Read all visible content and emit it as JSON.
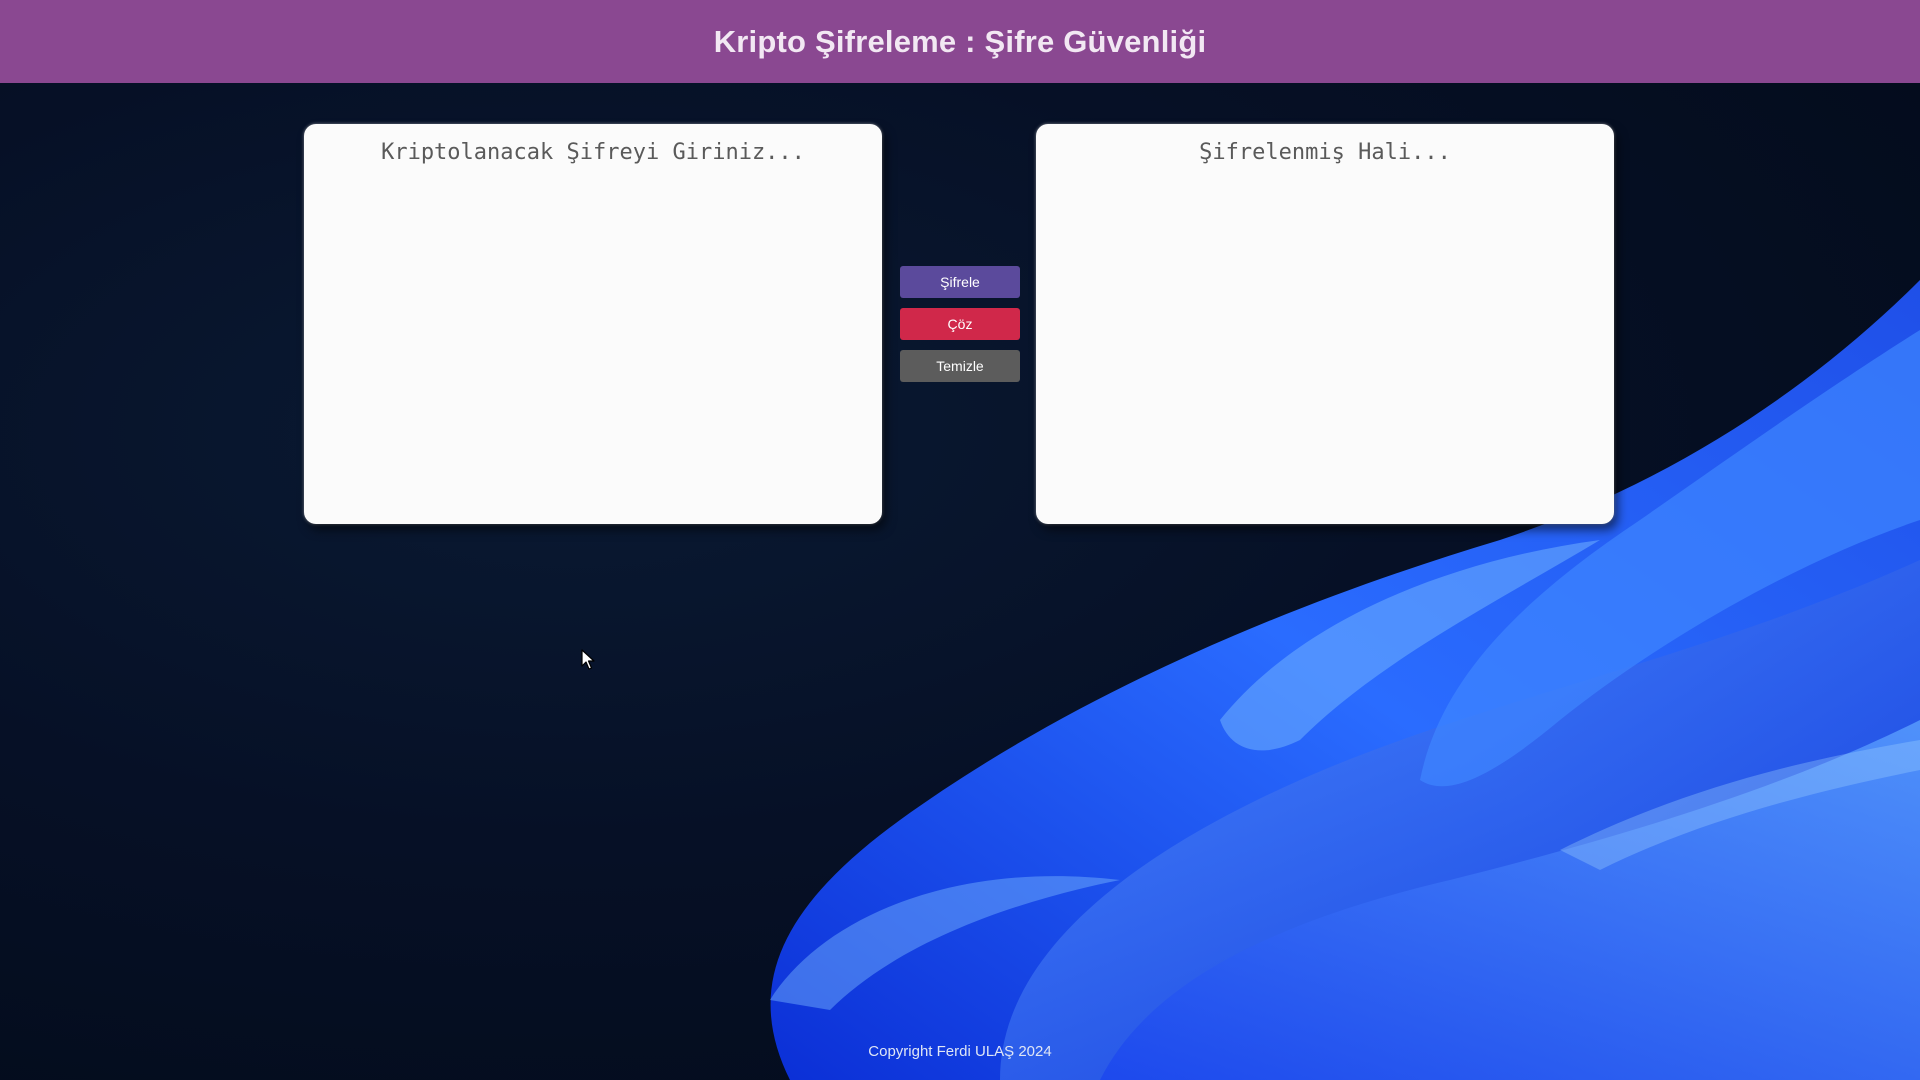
{
  "header": {
    "title": "Kripto Şifreleme : Şifre Güvenliği"
  },
  "input_panel": {
    "value": "",
    "placeholder": "Kriptolanacak Şifreyi Giriniz..."
  },
  "output_panel": {
    "value": "",
    "placeholder": "Şifrelenmiş Hali..."
  },
  "actions": {
    "encrypt_label": "Şifrele",
    "decrypt_label": "Çöz",
    "clear_label": "Temizle"
  },
  "footer": {
    "copyright": "Copyright Ferdi ULAŞ 2024"
  },
  "colors": {
    "header_bg": "#8a4891",
    "encrypt_button": "#5b4a9c",
    "decrypt_button": "#d0284a",
    "clear_button": "#5c5c5c",
    "background": "#061026",
    "wallpaper_accent": "#1f5bff"
  },
  "icons": {
    "pointer": "mouse-pointer-icon"
  }
}
